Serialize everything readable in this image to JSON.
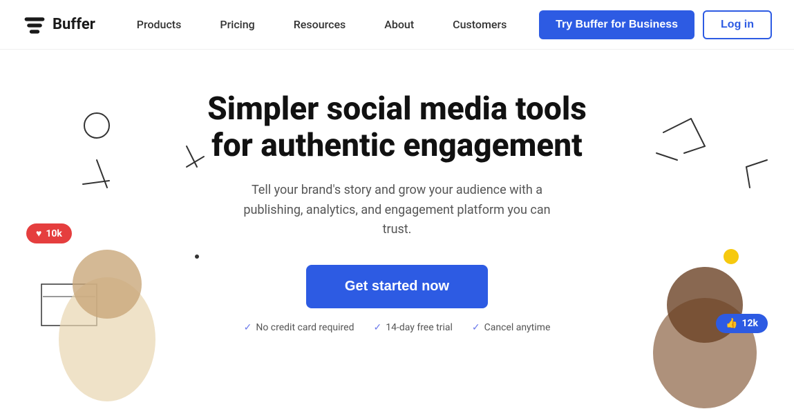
{
  "nav": {
    "logo_text": "Buffer",
    "links": [
      {
        "label": "Products",
        "id": "products"
      },
      {
        "label": "Pricing",
        "id": "pricing"
      },
      {
        "label": "Resources",
        "id": "resources"
      },
      {
        "label": "About",
        "id": "about"
      },
      {
        "label": "Customers",
        "id": "customers"
      }
    ],
    "try_button": "Try Buffer for Business",
    "login_button": "Log in"
  },
  "hero": {
    "title": "Simpler social media tools for authentic engagement",
    "subtitle": "Tell your brand's story and grow your audience with a publishing, analytics, and engagement platform you can trust.",
    "cta_button": "Get started now",
    "checks": [
      {
        "label": "No credit card required"
      },
      {
        "label": "14-day free trial"
      },
      {
        "label": "Cancel anytime"
      }
    ]
  },
  "badges": {
    "left": {
      "icon": "♥",
      "count": "10k"
    },
    "right": {
      "icon": "👍",
      "count": "12k"
    }
  },
  "colors": {
    "primary": "#2D5BE3",
    "cta": "#2D5BE3",
    "badge_red": "#e53e3e",
    "badge_blue": "#2D5BE3",
    "yellow": "#f6c90e"
  }
}
